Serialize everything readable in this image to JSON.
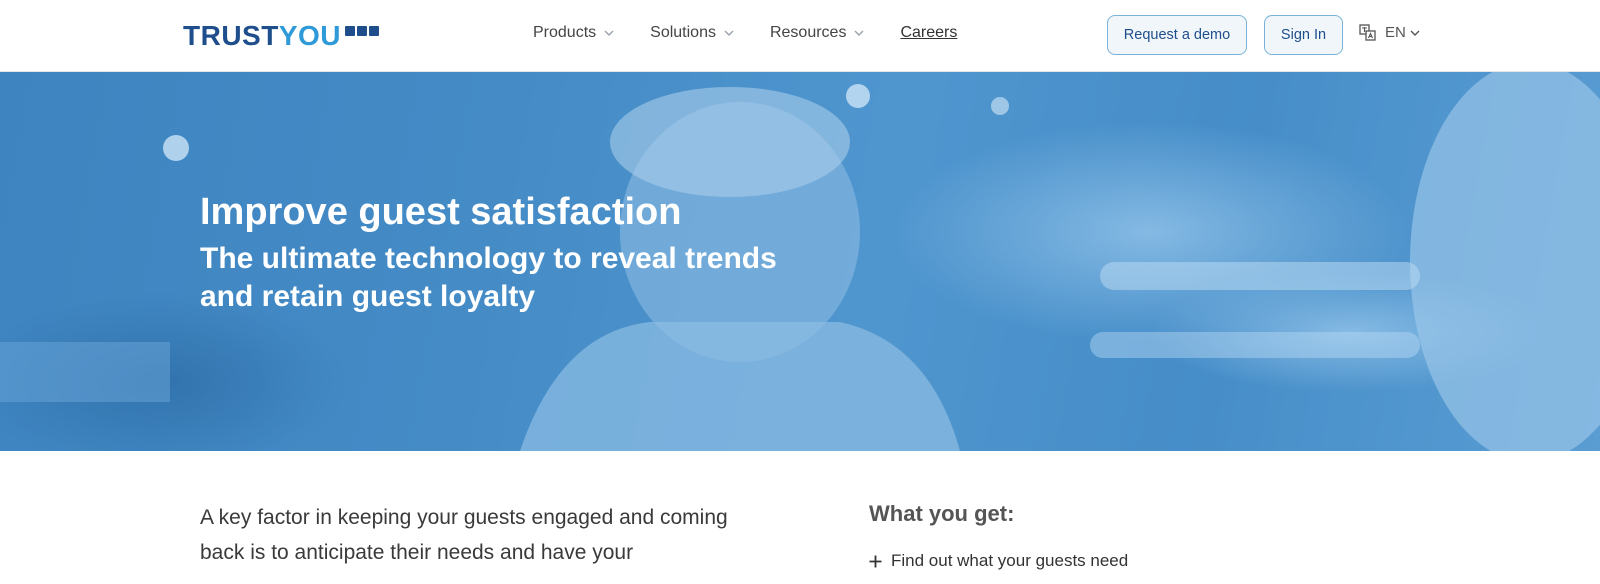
{
  "brand": {
    "part1": "TRUST",
    "part2": "YOU",
    "primary_color": "#1f4e8c",
    "accent_color": "#2f9ad8"
  },
  "nav": {
    "items": [
      {
        "label": "Products",
        "has_dropdown": true
      },
      {
        "label": "Solutions",
        "has_dropdown": true
      },
      {
        "label": "Resources",
        "has_dropdown": true
      },
      {
        "label": "Careers",
        "has_dropdown": false
      }
    ],
    "request_demo_label": "Request a demo",
    "sign_in_label": "Sign In",
    "language": {
      "icon": "translate-icon",
      "label": "EN"
    }
  },
  "hero": {
    "title": "Improve guest satisfaction",
    "subtitle": "The ultimate technology to reveal trends and retain guest loyalty",
    "overlay_color": "#4a92cc"
  },
  "content": {
    "intro_text": "A key factor in keeping your guests engaged and coming back is to anticipate their needs and have your",
    "what_you_get": {
      "title": "What you get:",
      "items": [
        {
          "icon": "plus-icon",
          "label": "Find out what your guests need"
        }
      ]
    }
  }
}
